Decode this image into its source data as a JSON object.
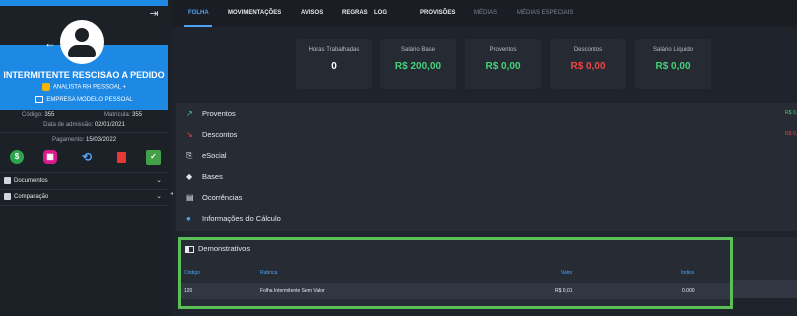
{
  "sidebar": {
    "name": "INTERMITENTE RESCISAO A PEDIDO",
    "role": "ANALISTA RH PESSOAL +",
    "company": "EMPRESA MODELO PESSOAL",
    "codigo_label": "Código:",
    "codigo_value": "355",
    "matricula_label": "Matrícula:",
    "matricula_value": "355",
    "admissao_label": "Data de admissão:",
    "admissao_value": "02/01/2021",
    "pagamento_label": "Pagamento:",
    "pagamento_value": "15/03/2022",
    "actions": [
      "money-icon",
      "calculator-icon",
      "restore-icon",
      "trash-icon",
      "check-icon"
    ],
    "menu": [
      {
        "label": "Documentos"
      },
      {
        "label": "Comparação"
      }
    ]
  },
  "tabs": [
    {
      "label": "FOLHA",
      "state": "active"
    },
    {
      "label": "MOVIMENTAÇÕES",
      "state": "normal"
    },
    {
      "label": "AVISOS",
      "state": "normal"
    },
    {
      "label": "REGRAS",
      "state": "normal"
    },
    {
      "label": "LOG",
      "state": "normal"
    },
    {
      "label": "PROVISÕES",
      "state": "normal"
    },
    {
      "label": "MÉDIAS",
      "state": "disabled"
    },
    {
      "label": "MÉDIAS ESPECIAIS",
      "state": "disabled"
    }
  ],
  "cards": [
    {
      "label": "Horas Trabalhadas",
      "value": "0",
      "color": "white"
    },
    {
      "label": "Salário Base",
      "value": "R$ 200,00",
      "color": "green"
    },
    {
      "label": "Proventos",
      "value": "R$ 0,00",
      "color": "green"
    },
    {
      "label": "Descontos",
      "value": "R$ 0,00",
      "color": "red"
    },
    {
      "label": "Salário Líquido",
      "value": "R$ 0,00",
      "color": "green"
    }
  ],
  "panel_rows": [
    {
      "label": "Proventos",
      "icon": "trending-up-icon",
      "amount": "R$ 0,",
      "amount_color": "green"
    },
    {
      "label": "Descontos",
      "icon": "trending-down-icon",
      "amount": "R$ 0,",
      "amount_color": "red"
    },
    {
      "label": "eSocial",
      "icon": "esocial-icon"
    },
    {
      "label": "Bases",
      "icon": "layers-icon"
    },
    {
      "label": "Ocorrências",
      "icon": "clipboard-icon"
    },
    {
      "label": "Informações do Cálculo",
      "icon": "info-icon"
    }
  ],
  "demonstrativos": {
    "title": "Demonstrativos",
    "columns": [
      "Código",
      "Rubrica",
      "Valor",
      "Índice"
    ],
    "rows": [
      {
        "codigo": "120",
        "rubrica": "Folha Intermitente Sem Valor",
        "valor": "R$ 0,01",
        "indice": "0.000"
      }
    ]
  },
  "colors": {
    "accent": "#1e88e5",
    "highlight_border": "#5cbe56",
    "positive": "#43d17a",
    "negative": "#ef4444"
  }
}
